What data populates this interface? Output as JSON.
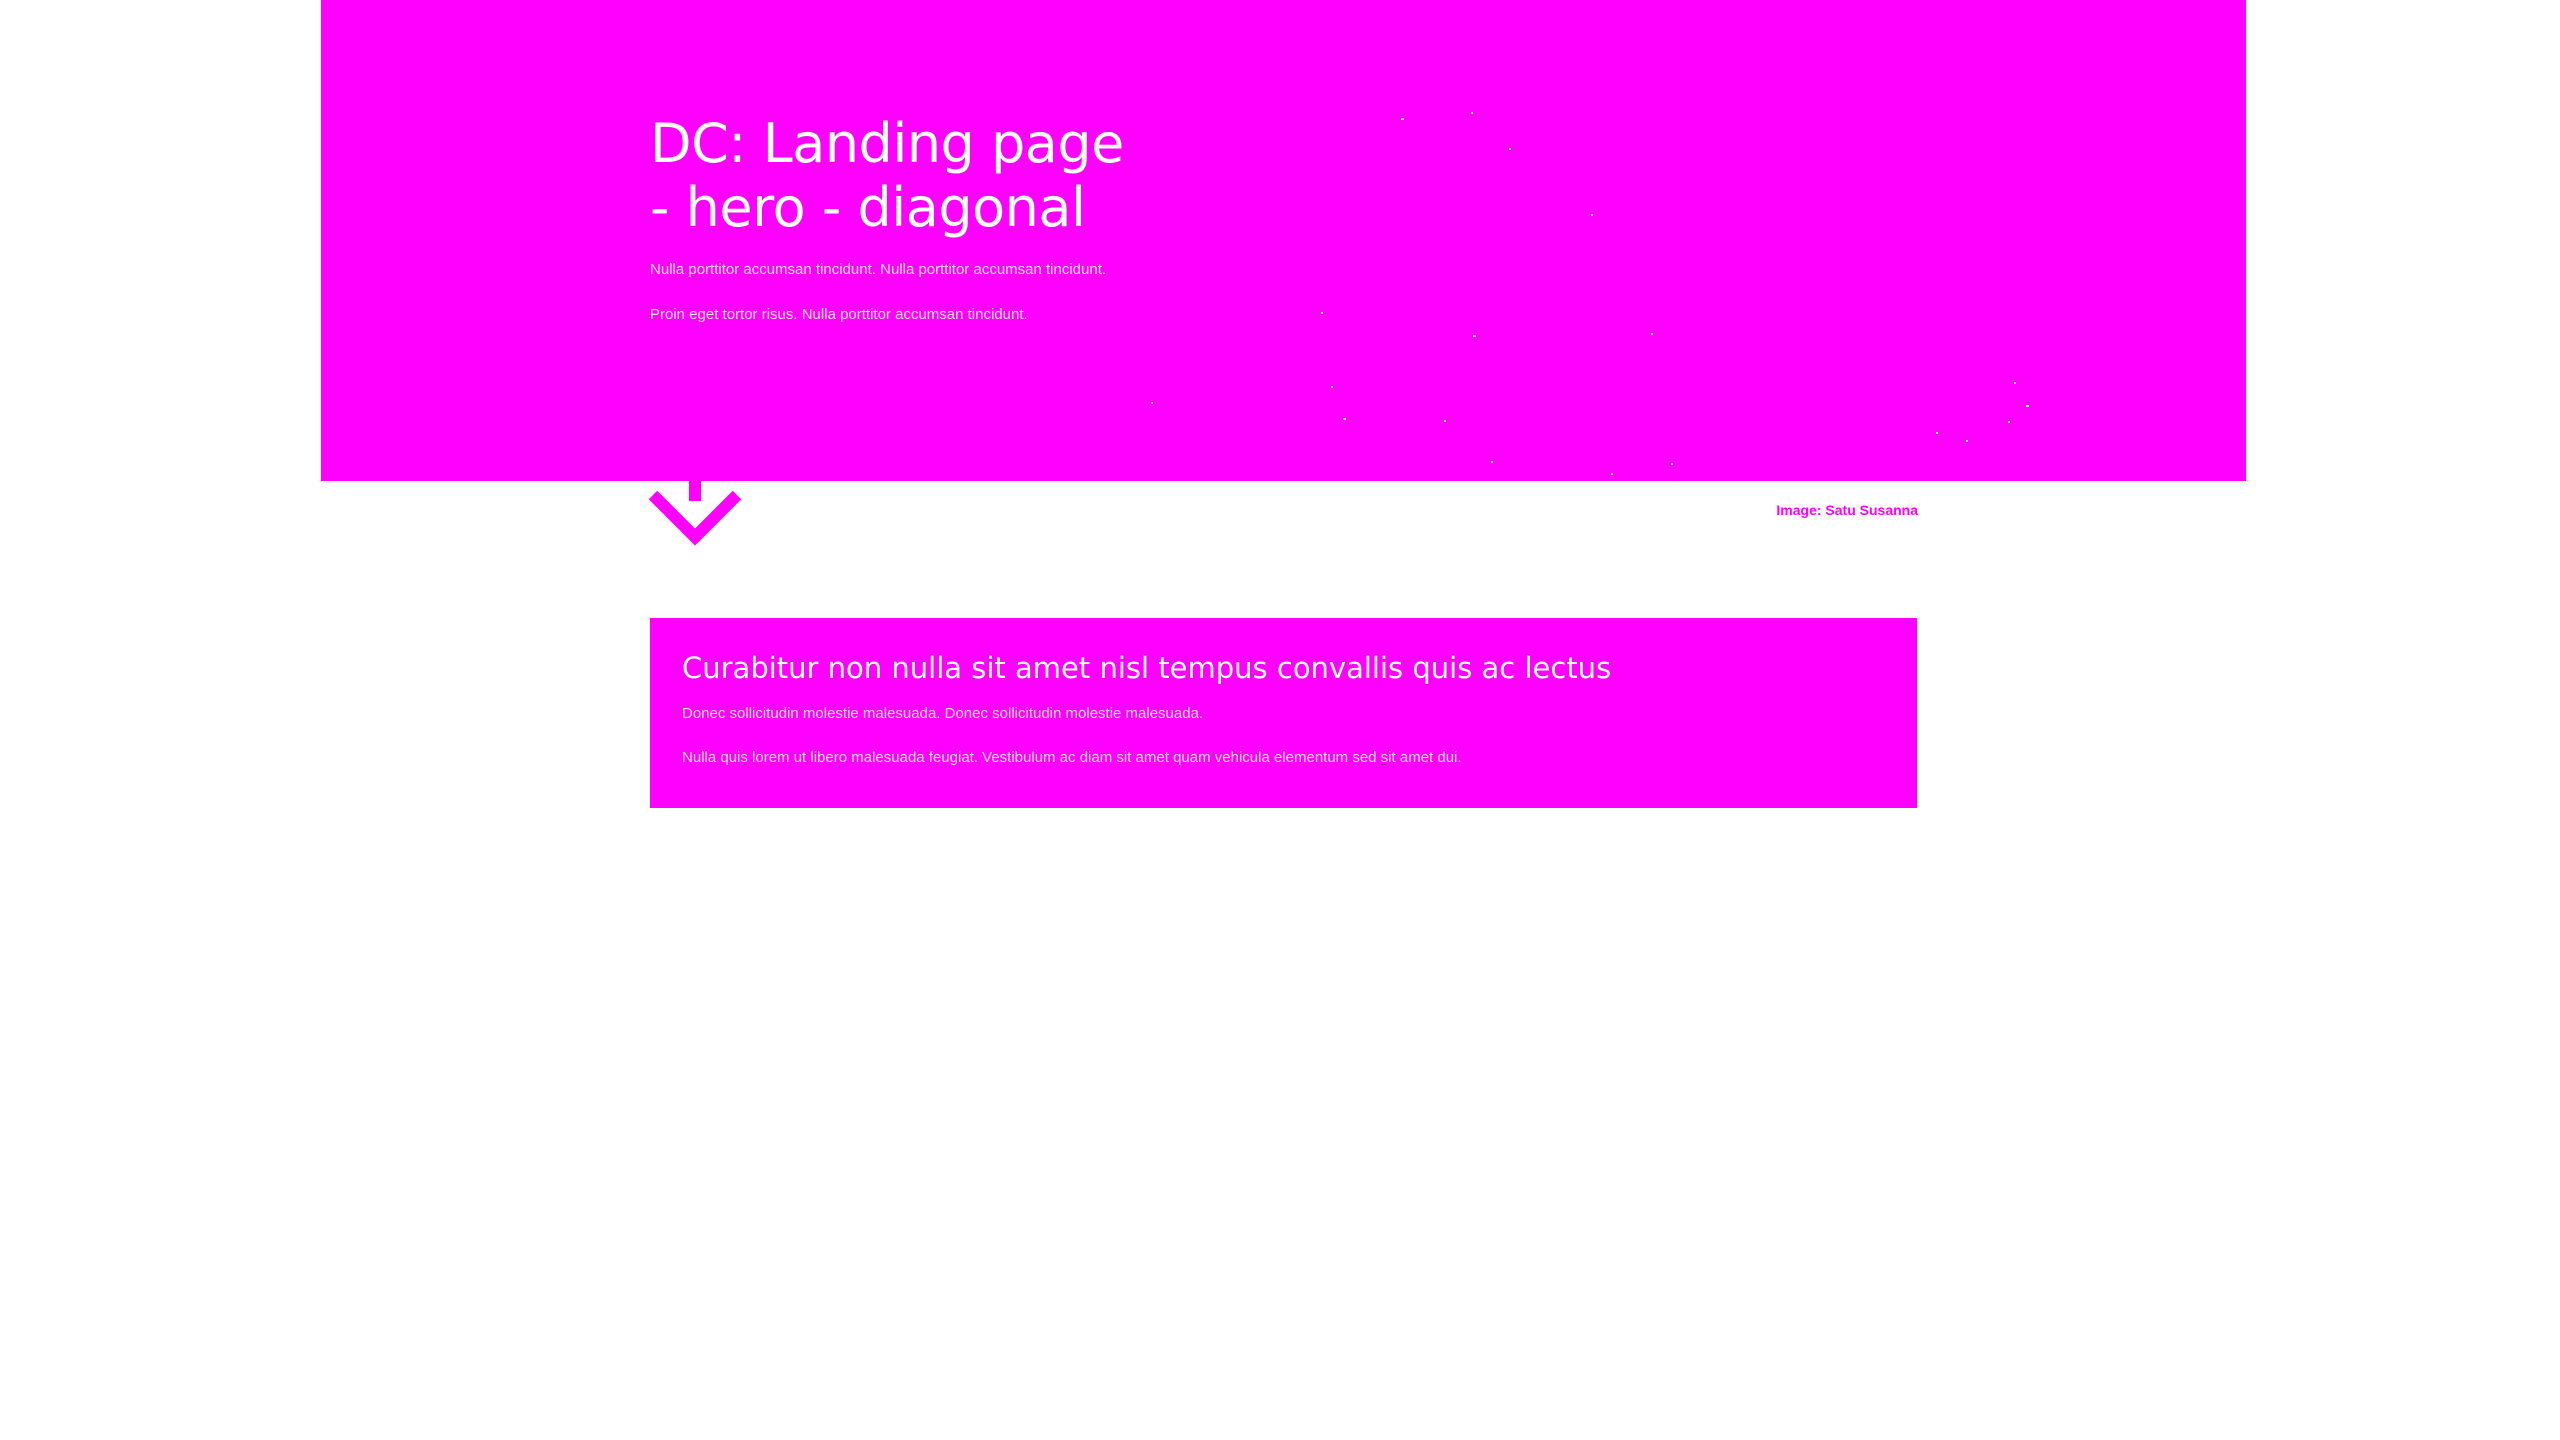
{
  "hero": {
    "title_line1": "DC: Landing page",
    "title_line2": "- hero - diagonal",
    "paragraph1": "Nulla porttitor accumsan tincidunt. Nulla porttitor accumsan tincidunt.",
    "paragraph2": "Proin eget tortor risus. Nulla porttitor accumsan tincidunt.",
    "background_color": "#ff00ff"
  },
  "scroll_indicator": {
    "icon": "arrow-down-icon"
  },
  "image_credit": "Image: Satu Susanna",
  "callout": {
    "title": "Curabitur non nulla sit amet nisl tempus convallis quis ac lectus",
    "paragraph1": "Donec sollicitudin molestie malesuada. Donec sollicitudin molestie malesuada.",
    "paragraph2": "Nulla quis lorem ut libero malesuada feugiat. Vestibulum ac diam sit amet quam vehicula elementum sed sit amet dui.",
    "background_color": "#ff00ff"
  },
  "colors": {
    "accent": "#ff00ff",
    "text_on_accent": "#ffffff",
    "page_background": "#ffffff"
  }
}
